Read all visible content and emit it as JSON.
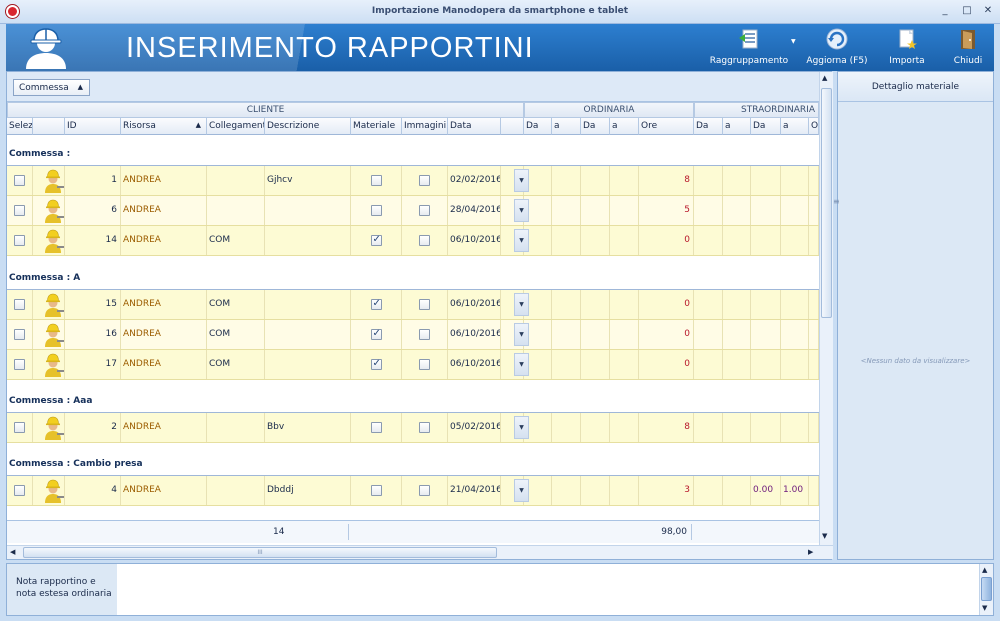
{
  "window": {
    "title": "Importazione Manodopera da smartphone e tablet",
    "min": "_",
    "max": "□",
    "close": "✕"
  },
  "banner": {
    "title": "INSERIMENTO RAPPORTINI"
  },
  "toolbar": {
    "raggruppamento": "Raggruppamento",
    "aggiorna": "Aggiorna (F5)",
    "importa": "Importa",
    "chiudi": "Chiudi"
  },
  "grouping": {
    "chip_label": "Commessa",
    "chip_arrow": "▲"
  },
  "bands": {
    "cliente": "CLIENTE",
    "ordinaria": "ORDINARIA",
    "straordinaria": "STRAORDINARIA"
  },
  "columns": {
    "selez": "Selez",
    "id": "ID",
    "risorsa": "Risorsa",
    "risorsa_sort": "▲",
    "collegamento": "Collegamento",
    "descrizione": "Descrizione",
    "materiale": "Materiale",
    "immagini": "Immagini",
    "data": "Data",
    "ord_da1": "Da",
    "ord_a1": "a",
    "ord_da2": "Da",
    "ord_a2": "a",
    "ore": "Ore",
    "str_da1": "Da",
    "str_a1": "a",
    "str_da2": "Da",
    "str_a2": "a",
    "str_or": "Or"
  },
  "groups": [
    {
      "label": "Commessa :",
      "rows": [
        {
          "id": "1",
          "risorsa": "ANDREA",
          "collegamento": "",
          "descrizione": "Gjhcv",
          "materiale": false,
          "immagini": false,
          "data": "02/02/2016",
          "ore": "8",
          "str_da2": "",
          "str_a2": ""
        },
        {
          "id": "6",
          "risorsa": "ANDREA",
          "collegamento": "",
          "descrizione": "",
          "materiale": false,
          "immagini": false,
          "data": "28/04/2016",
          "ore": "5",
          "str_da2": "",
          "str_a2": ""
        },
        {
          "id": "14",
          "risorsa": "ANDREA",
          "collegamento": "COM",
          "descrizione": "",
          "materiale": true,
          "immagini": false,
          "data": "06/10/2016",
          "ore": "0",
          "str_da2": "",
          "str_a2": ""
        }
      ]
    },
    {
      "label": "Commessa : A",
      "rows": [
        {
          "id": "15",
          "risorsa": "ANDREA",
          "collegamento": "COM",
          "descrizione": "",
          "materiale": true,
          "immagini": false,
          "data": "06/10/2016",
          "ore": "0",
          "str_da2": "",
          "str_a2": ""
        },
        {
          "id": "16",
          "risorsa": "ANDREA",
          "collegamento": "COM",
          "descrizione": "",
          "materiale": true,
          "immagini": false,
          "data": "06/10/2016",
          "ore": "0",
          "str_da2": "",
          "str_a2": ""
        },
        {
          "id": "17",
          "risorsa": "ANDREA",
          "collegamento": "COM",
          "descrizione": "",
          "materiale": true,
          "immagini": false,
          "data": "06/10/2016",
          "ore": "0",
          "str_da2": "",
          "str_a2": ""
        }
      ]
    },
    {
      "label": "Commessa : Aaa",
      "rows": [
        {
          "id": "2",
          "risorsa": "ANDREA",
          "collegamento": "",
          "descrizione": "Bbv",
          "materiale": false,
          "immagini": false,
          "data": "05/02/2016",
          "ore": "8",
          "str_da2": "",
          "str_a2": ""
        }
      ]
    },
    {
      "label": "Commessa : Cambio presa",
      "rows": [
        {
          "id": "4",
          "risorsa": "ANDREA",
          "collegamento": "",
          "descrizione": "Dbddj",
          "materiale": false,
          "immagini": false,
          "data": "21/04/2016",
          "ore": "3",
          "str_da2": "0.00",
          "str_a2": "1.00"
        }
      ]
    }
  ],
  "footer": {
    "count": "14",
    "total_ore": "98,00"
  },
  "scroll": {
    "up": "▲",
    "down": "▼",
    "left": "◀",
    "right": "▶",
    "grip": "III"
  },
  "detail": {
    "header": "Dettaglio materiale",
    "empty": "<Nessun dato da visualizzare>"
  },
  "nota": {
    "label": "Nota rapportino e nota estesa ordinaria",
    "value": ""
  },
  "colors": {
    "header_blue": "#1a5fa8",
    "row_yellow": "#fdfbd4",
    "ore_red": "#b8162a",
    "risorsa_orange": "#9c5d00"
  }
}
